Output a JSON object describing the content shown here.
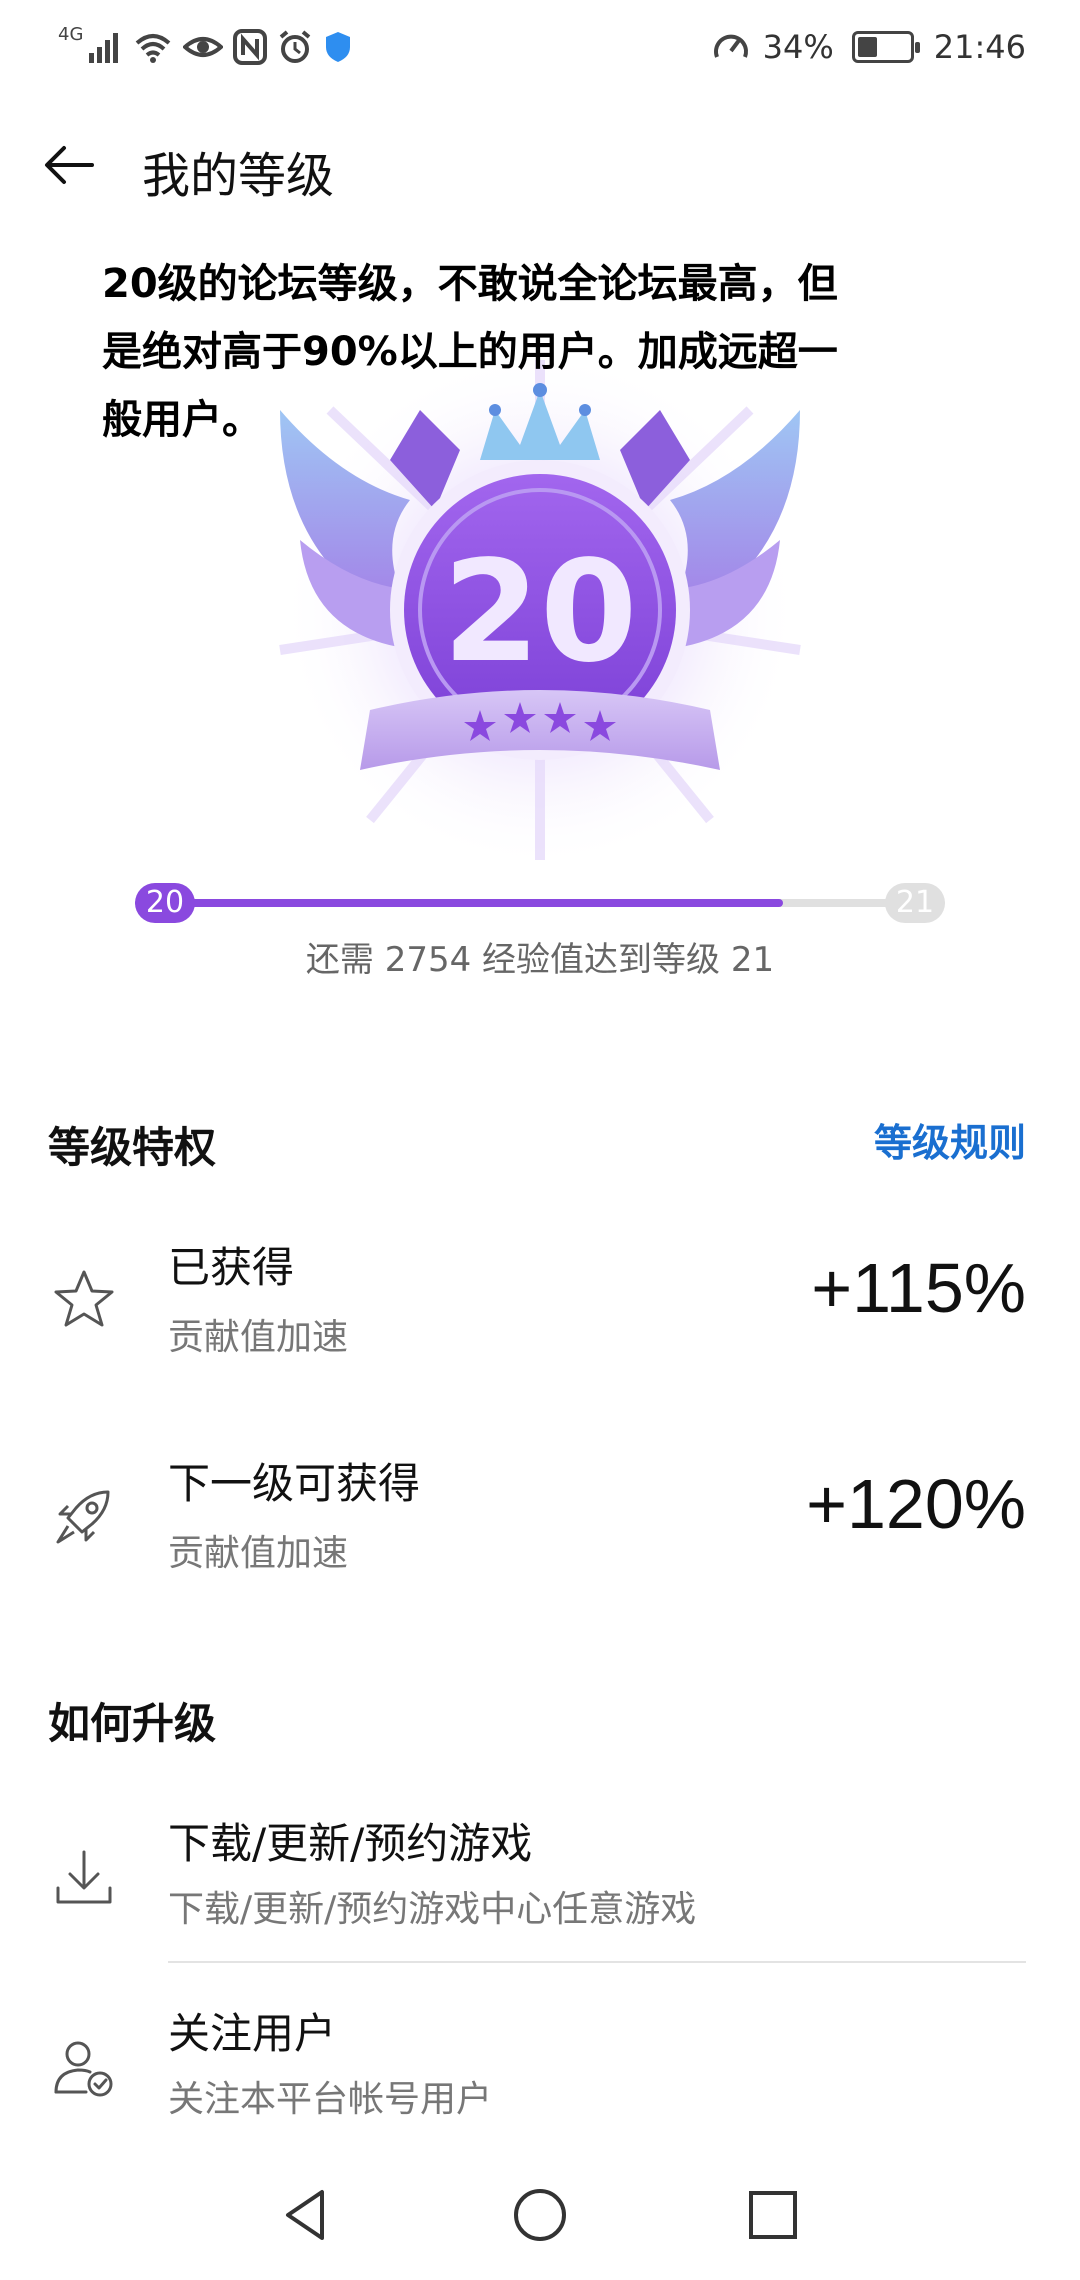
{
  "status_bar": {
    "network_type": "4G",
    "icons": [
      "signal-icon",
      "wifi-icon",
      "eye-comfort-icon",
      "nfc-icon",
      "alarm-icon",
      "shield-icon"
    ],
    "right_icons": [
      "data-saver-icon",
      "battery-icon"
    ],
    "battery_percent": "34%",
    "battery_level": 0.34,
    "time": "21:46"
  },
  "header": {
    "title": "我的等级",
    "back_icon": "arrow-left-icon"
  },
  "hero": {
    "intro": "20级的论坛等级，不敢说全论坛最高，但是绝对高于90%以上的用户。加成远超一般用户。",
    "badge_level": "20",
    "badge_colors": {
      "primary": "#8a49df",
      "light": "#c9b6f2",
      "wing": "#a5a6ef"
    }
  },
  "progress": {
    "current_level": "20",
    "next_level": "21",
    "fill_fraction": 0.8,
    "caption": "还需 2754 经验值达到等级 21"
  },
  "privileges": {
    "section_title": "等级特权",
    "rules_link": "等级规则",
    "items": [
      {
        "icon": "star-icon",
        "title": "已获得",
        "subtitle": "贡献值加速",
        "value": "+115%"
      },
      {
        "icon": "rocket-icon",
        "title": "下一级可获得",
        "subtitle": "贡献值加速",
        "value": "+120%"
      }
    ]
  },
  "upgrade": {
    "section_title": "如何升级",
    "items": [
      {
        "icon": "download-icon",
        "title": "下载/更新/预约游戏",
        "subtitle": "下载/更新/预约游戏中心任意游戏"
      },
      {
        "icon": "follow-user-icon",
        "title": "关注用户",
        "subtitle": "关注本平台帐号用户"
      }
    ]
  },
  "nav_bar": {
    "buttons": [
      "back-triangle-icon",
      "home-circle-icon",
      "recents-square-icon"
    ]
  },
  "colors": {
    "accent": "#8a49df",
    "link": "#1a6fd0",
    "muted_text": "#777777"
  }
}
